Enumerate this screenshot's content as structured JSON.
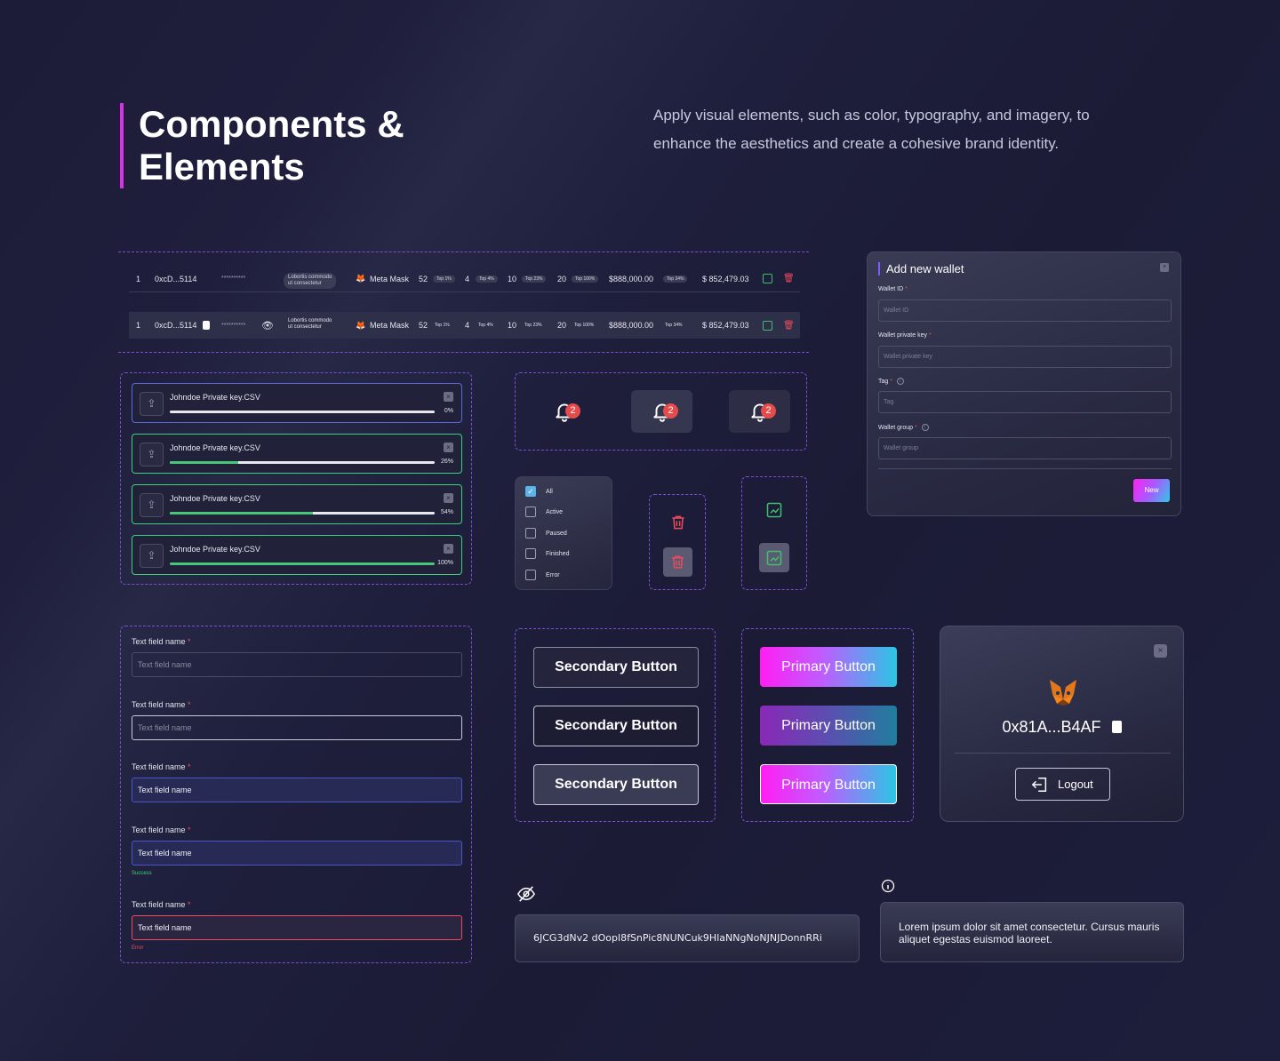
{
  "header": {
    "title_line1": "Components &",
    "title_line2": "Elements",
    "subtitle": "Apply visual elements, such as color, typography, and imagery, to enhance the aesthetics and create a cohesive brand identity."
  },
  "table": {
    "rows": [
      {
        "index": "1",
        "address": "0xcD...5114",
        "secret": "**********",
        "note_line1": "Lobortis commodo",
        "note_line2": "ut consectetur",
        "wallet": "Meta Mask",
        "c1": "52",
        "t1": "Top 1%",
        "c2": "4",
        "t2": "Top 4%",
        "c3": "10",
        "t3": "Top 23%",
        "c4": "20",
        "t4": "Top 100%",
        "amount": "$888,000.00",
        "t5": "Top 34%",
        "balance": "$ 852,479.03"
      },
      {
        "index": "1",
        "address": "0xcD...5114",
        "secret": "**********",
        "note_line1": "Lobortis commodo",
        "note_line2": "ut consectetur",
        "wallet": "Meta Mask",
        "c1": "52",
        "t1": "Top 1%",
        "c2": "4",
        "t2": "Top 4%",
        "c3": "10",
        "t3": "Top 23%",
        "c4": "20",
        "t4": "Top 100%",
        "amount": "$888,000.00",
        "t5": "Top 34%",
        "balance": "$ 852,479.03"
      }
    ]
  },
  "uploads": [
    {
      "file": "Johndoe Private key.CSV",
      "progress": 0,
      "label": "0%"
    },
    {
      "file": "Johndoe Private key.CSV",
      "progress": 0.26,
      "label": "26%"
    },
    {
      "file": "Johndoe Private key.CSV",
      "progress": 0.54,
      "label": "54%"
    },
    {
      "file": "Johndoe Private key.CSV",
      "progress": 1.0,
      "label": "100%"
    }
  ],
  "bells": [
    {
      "count": "2",
      "icon": "bell-icon"
    },
    {
      "count": "2",
      "icon": "bell-icon"
    },
    {
      "count": "2",
      "icon": "bell-icon"
    }
  ],
  "filter": {
    "options": [
      {
        "label": "All",
        "checked": true
      },
      {
        "label": "Active",
        "checked": false
      },
      {
        "label": "Paused",
        "checked": false
      },
      {
        "label": "Finished",
        "checked": false
      },
      {
        "label": "Error",
        "checked": false
      }
    ]
  },
  "modal": {
    "title": "Add new wallet",
    "fields": [
      {
        "label": "Wallet ID",
        "required": "*",
        "placeholder": "Wallet ID"
      },
      {
        "label": "Wallet private key",
        "required": "*",
        "placeholder": "Wallet private key"
      },
      {
        "label": "Tag",
        "required": "*",
        "placeholder": "Tag"
      },
      {
        "label": "Wallet group",
        "required": "*",
        "placeholder": "Wallet group"
      }
    ],
    "submit_label": "New"
  },
  "text_fields": [
    {
      "label": "Text field name",
      "required": "*",
      "value": "Text field name",
      "state": "default"
    },
    {
      "label": "Text field name",
      "required": "*",
      "value": "Text field name",
      "state": "hover"
    },
    {
      "label": "Text field name",
      "required": "*",
      "value": "Text field name",
      "state": "focus"
    },
    {
      "label": "Text field name",
      "required": "*",
      "value": "Text field name",
      "state": "success",
      "help": "Success"
    },
    {
      "label": "Text field name",
      "required": "*",
      "value": "Text field name",
      "state": "error",
      "help": "Error"
    }
  ],
  "secondary_buttons": [
    "Secondary Button",
    "Secondary Button",
    "Secondary Button"
  ],
  "primary_buttons": [
    "Primary Button",
    "Primary Button",
    "Primary Button"
  ],
  "wallet_card": {
    "address": "0x81A...B4AF",
    "logout_label": "Logout"
  },
  "secret_key": "6JCG3dNv2 dOopl8fSnPic8NUNCuk9HlaNNgNoNJNJDonnRRi",
  "tooltip_text": "Lorem ipsum dolor sit amet consectetur. Cursus mauris aliquet egestas euismod laoreet.",
  "colors": {
    "accent_magenta": "#d633e8",
    "dashed_border": "#7a4fd6",
    "success": "#3fd07c",
    "error": "#ee4b5c"
  }
}
